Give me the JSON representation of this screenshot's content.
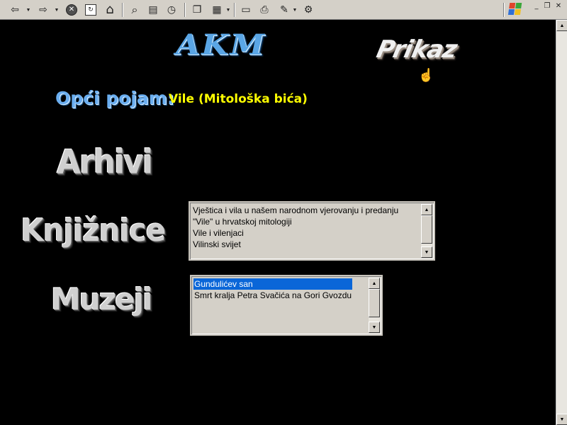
{
  "toolbar": {
    "buttons": [
      {
        "name": "back-button",
        "icon": "back-arrow-icon",
        "glyph": "⇦"
      },
      {
        "name": "forward-button",
        "icon": "forward-arrow-icon",
        "glyph": "⇨"
      },
      {
        "name": "stop-button",
        "icon": "stop-icon",
        "glyph": "✕"
      },
      {
        "name": "refresh-button",
        "icon": "refresh-icon",
        "glyph": "↻"
      },
      {
        "name": "home-button",
        "icon": "home-icon",
        "glyph": "⌂"
      },
      {
        "name": "search-button",
        "icon": "search-icon",
        "glyph": "⌕"
      },
      {
        "name": "favorites-button",
        "icon": "favorites-folder-icon",
        "glyph": "▤"
      },
      {
        "name": "history-button",
        "icon": "history-icon",
        "glyph": "◷"
      },
      {
        "name": "copy-button",
        "icon": "copy-icon",
        "glyph": "❐"
      },
      {
        "name": "format-button",
        "icon": "format-icon",
        "glyph": "▦"
      },
      {
        "name": "window-button",
        "icon": "window-icon",
        "glyph": "▭"
      },
      {
        "name": "print-button",
        "icon": "print-icon",
        "glyph": "⎙"
      },
      {
        "name": "edit-button",
        "icon": "edit-icon",
        "glyph": "✎"
      },
      {
        "name": "tools-button",
        "icon": "tools-icon",
        "glyph": "⚙"
      }
    ],
    "window_controls": {
      "minimize": "_",
      "restore": "❐",
      "close": "✕"
    }
  },
  "logos": {
    "akm": "AKM",
    "prikaz": "Prikaz"
  },
  "pojam": {
    "label": "Opći pojam:",
    "value": "Vile (Mitološka bića)"
  },
  "sections": {
    "arhivi": "Arhivi",
    "knjiznice": "Knjižnice",
    "muzeji": "Muzeji"
  },
  "knjiznice_list": [
    "Vještica i vila u našem narodnom vjerovanju i predanju",
    "\"Vile\" u hrvatskoj mitologiji",
    "Vile i vilenjaci",
    "Vilinski svijet"
  ],
  "muzeji_list": [
    {
      "label": "Gundulićev san",
      "selected": true
    },
    {
      "label": "Smrt kralja Petra Svačića na Gori Gvozdu",
      "selected": false
    }
  ],
  "colors": {
    "page_background": "#000000",
    "pojam_value": "#ffff00",
    "selection": "#0a66d8",
    "toolbar": "#d4d0c8"
  },
  "arrows": {
    "up": "▲",
    "down": "▼"
  },
  "cursor": "hand-pointer-icon"
}
